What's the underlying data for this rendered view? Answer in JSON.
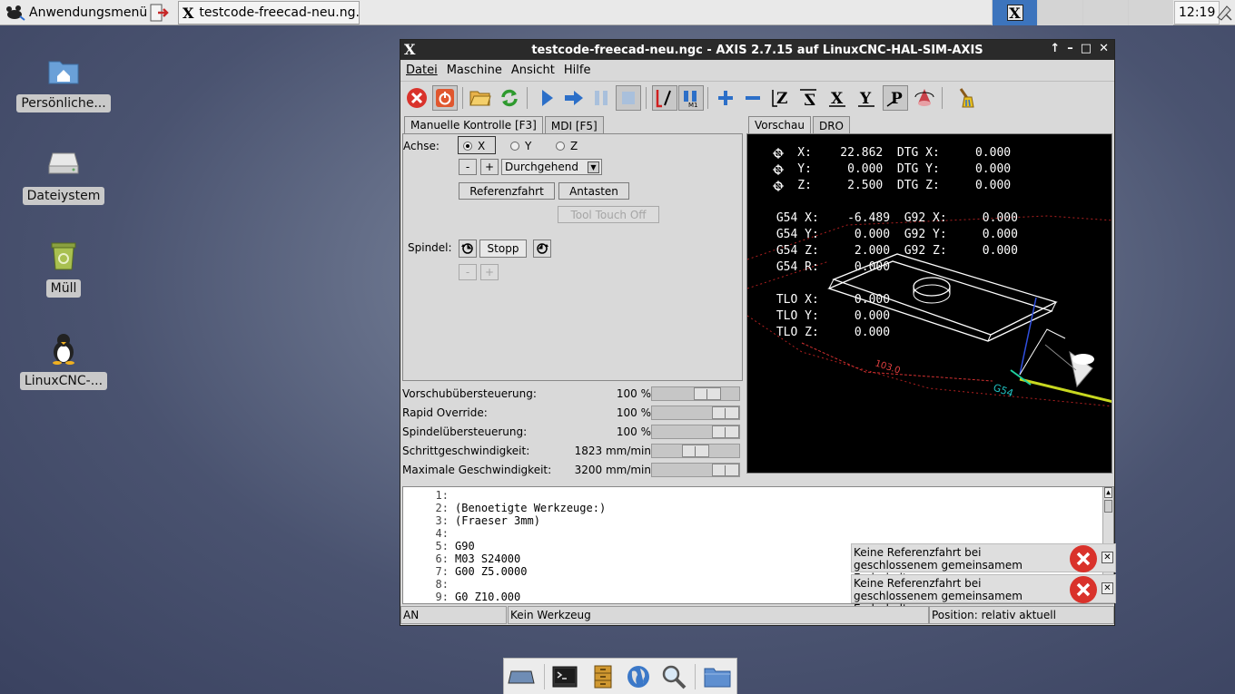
{
  "taskbar": {
    "app_menu_label": "Anwendungsmenü",
    "task_title": "testcode-freecad-neu.ng...",
    "clock": "12:19"
  },
  "desktop": {
    "icons": [
      {
        "label": "Persönliche...",
        "icon": "home-folder-icon"
      },
      {
        "label": "Dateiystem",
        "icon": "drive-icon"
      },
      {
        "label": "Müll",
        "icon": "trash-icon"
      },
      {
        "label": "LinuxCNC-...",
        "icon": "tux-icon"
      }
    ]
  },
  "window": {
    "title": "testcode-freecad-neu.ngc - AXIS 2.7.15 auf  LinuxCNC-HAL-SIM-AXIS",
    "controls": [
      "↑",
      "–",
      "□",
      "✕"
    ],
    "menu": [
      "Datei",
      "Maschine",
      "Ansicht",
      "Hilfe"
    ],
    "left_tabs": [
      "Manuelle Kontrolle [F3]",
      "MDI [F5]"
    ],
    "right_tabs": [
      "Vorschau",
      "DRO"
    ],
    "manual": {
      "achse_label": "Achse:",
      "axes": [
        "X",
        "Y",
        "Z"
      ],
      "selected_axis": "X",
      "minus": "-",
      "plus": "+",
      "jog_mode": "Durchgehend",
      "home_button": "Referenzfahrt",
      "touch_button": "Antasten",
      "tool_touch_off": "Tool Touch Off",
      "spindle_label": "Spindel:",
      "spindle_stop": "Stopp",
      "spindle_minus": "-",
      "spindle_plus": "+"
    },
    "sliders": [
      {
        "name": "Vorschubübersteuerung:",
        "value": "100 %",
        "level": 0.7
      },
      {
        "name": "Rapid Override:",
        "value": "100 %",
        "level": 1.0
      },
      {
        "name": "Spindelübersteuerung:",
        "value": "100 %",
        "level": 1.0
      },
      {
        "name": "Schrittgeschwindigkeit:",
        "value": "1823 mm/min",
        "level": 0.5
      },
      {
        "name": "Maximale Geschwindigkeit:",
        "value": "3200 mm/min",
        "level": 1.0
      }
    ],
    "dro": [
      {
        "text": "    X:    22.862  DTG X:     0.000",
        "homed": true
      },
      {
        "text": "    Y:     0.000  DTG Y:     0.000",
        "homed": true
      },
      {
        "text": "    Z:     2.500  DTG Z:     0.000",
        "homed": true
      },
      {
        "text": "",
        "homed": false
      },
      {
        "text": " G54 X:    -6.489  G92 X:     0.000",
        "homed": false
      },
      {
        "text": " G54 Y:     0.000  G92 Y:     0.000",
        "homed": false
      },
      {
        "text": " G54 Z:     2.000  G92 Z:     0.000",
        "homed": false
      },
      {
        "text": " G54 R:     0.000",
        "homed": false
      },
      {
        "text": "",
        "homed": false
      },
      {
        "text": " TLO X:     0.000",
        "homed": false
      },
      {
        "text": " TLO Y:     0.000",
        "homed": false
      },
      {
        "text": " TLO Z:     0.000",
        "homed": false
      }
    ],
    "preview_labels": {
      "dim_x": "103.0",
      "g54": "G54"
    },
    "gcode": [
      {
        "n": "1:",
        "t": ""
      },
      {
        "n": "2:",
        "t": "(Benoetigte Werkzeuge:)"
      },
      {
        "n": "3:",
        "t": "(Fraeser 3mm)"
      },
      {
        "n": "4:",
        "t": ""
      },
      {
        "n": "5:",
        "t": "G90"
      },
      {
        "n": "6:",
        "t": "M03 S24000"
      },
      {
        "n": "7:",
        "t": "G00 Z5.0000"
      },
      {
        "n": "8:",
        "t": ""
      },
      {
        "n": "9:",
        "t": "G0 Z10.000"
      }
    ],
    "notifications": [
      "Keine Referenzfahrt bei geschlossenem gemeinsamem Endschalter",
      "Keine Referenzfahrt bei geschlossenem gemeinsamem Endschalter"
    ],
    "status": {
      "state": "AN",
      "tool": "Kein Werkzeug",
      "position": "Position: relativ aktuell"
    }
  },
  "colors": {
    "estop_red": "#d9322b",
    "accent_blue": "#2c6fc8",
    "preview_bg": "#000000"
  }
}
